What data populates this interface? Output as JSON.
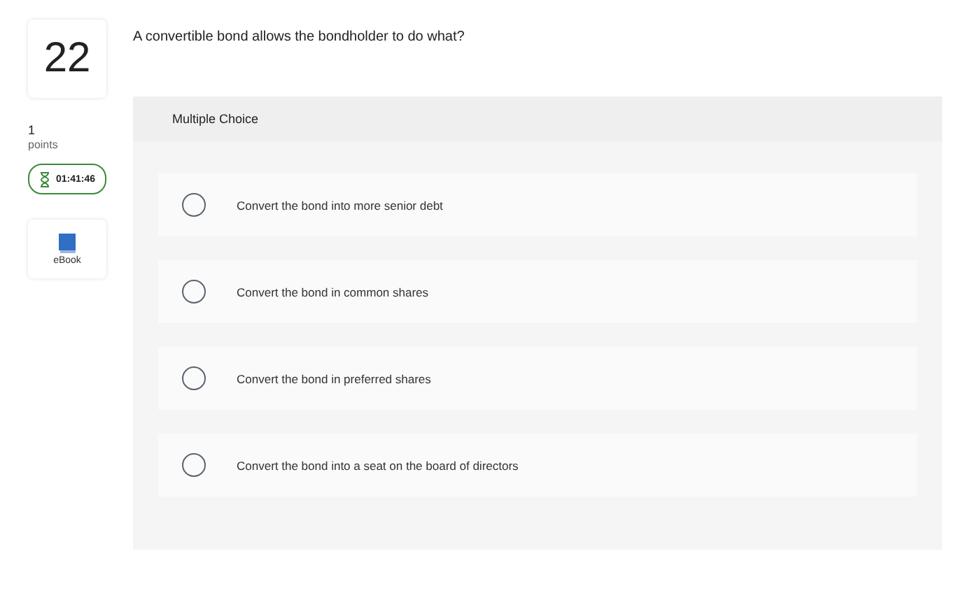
{
  "question": {
    "number": "22",
    "points_value": "1",
    "points_label": "points",
    "timer": "01:41:46",
    "ebook_label": "eBook",
    "prompt": "A convertible bond allows the bondholder to do what?"
  },
  "answer_panel": {
    "type_label": "Multiple Choice",
    "choices": [
      {
        "label": "Convert the bond into more senior debt",
        "selected": false
      },
      {
        "label": "Convert the bond in common shares",
        "selected": false
      },
      {
        "label": "Convert the bond in preferred shares",
        "selected": false
      },
      {
        "label": "Convert the bond into a seat on the board of directors",
        "selected": false
      }
    ]
  }
}
